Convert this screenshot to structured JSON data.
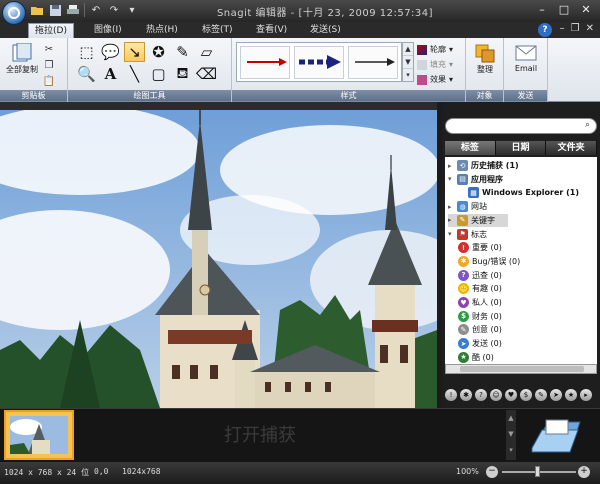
{
  "titlebar": {
    "title": "Snagit 编辑器 - [十月 23, 2009 12:57:34]",
    "qat_icons": [
      "folder-open-icon",
      "save-icon",
      "print-icon",
      "undo-icon",
      "redo-icon",
      "dropdown-icon"
    ]
  },
  "tabs": [
    {
      "label": "拖拉(D)",
      "active": true
    },
    {
      "label": "图像(I)",
      "active": false
    },
    {
      "label": "热点(H)",
      "active": false
    },
    {
      "label": "标签(T)",
      "active": false
    },
    {
      "label": "查看(V)",
      "active": false
    },
    {
      "label": "发送(S)",
      "active": false
    }
  ],
  "ribbon": {
    "clipboard": {
      "label": "剪贴板",
      "copy_all": "全部复制"
    },
    "drawing_tools": {
      "label": "绘图工具"
    },
    "styles": {
      "label": "样式",
      "outline": "轮廓",
      "fill": "填充",
      "effects": "效果"
    },
    "objects": {
      "label": "对象",
      "arrange": "整理"
    },
    "send": {
      "label": "发送",
      "email": "Email"
    }
  },
  "panel": {
    "search_placeholder": "",
    "tabs": [
      "标签",
      "日期",
      "文件夹"
    ],
    "tree": [
      {
        "label": "历史捕获  (1)",
        "indent": 0,
        "icon": "history-icon",
        "expander": "▸",
        "bold": true
      },
      {
        "label": "应用程序",
        "indent": 0,
        "icon": "application-icon",
        "expander": "▾",
        "bold": true
      },
      {
        "label": "Windows Explorer  (1)",
        "indent": 2,
        "icon": "windows-explorer-icon",
        "expander": "",
        "bold": true
      },
      {
        "label": "网站",
        "indent": 0,
        "icon": "web-icon",
        "expander": "▸",
        "bold": false
      },
      {
        "label": "关键字",
        "indent": 0,
        "icon": "keyword-icon",
        "expander": "▸",
        "bold": false,
        "selected": true
      },
      {
        "label": "标志",
        "indent": 0,
        "icon": "flag-icon",
        "expander": "▾",
        "bold": false
      },
      {
        "label": "重要  (0)",
        "indent": 1,
        "icon": "important-icon",
        "color": "#d32f2f",
        "glyph": "!"
      },
      {
        "label": "Bug/错误  (0)",
        "indent": 1,
        "icon": "bug-icon",
        "color": "#f5a623",
        "glyph": "✱"
      },
      {
        "label": "迅查  (0)",
        "indent": 1,
        "icon": "quick-review-icon",
        "color": "#7e57c2",
        "glyph": "?"
      },
      {
        "label": "有趣  (0)",
        "indent": 1,
        "icon": "interesting-icon",
        "color": "#f2b400",
        "glyph": "☺"
      },
      {
        "label": "私人  (0)",
        "indent": 1,
        "icon": "private-icon",
        "color": "#8e44ad",
        "glyph": "♥"
      },
      {
        "label": "财务  (0)",
        "indent": 1,
        "icon": "finance-icon",
        "color": "#2e9e44",
        "glyph": "$"
      },
      {
        "label": "创意  (0)",
        "indent": 1,
        "icon": "idea-icon",
        "color": "#8e8e8e",
        "glyph": "✎"
      },
      {
        "label": "发送  (0)",
        "indent": 1,
        "icon": "send-icon",
        "color": "#3a7bd5",
        "glyph": "➤"
      },
      {
        "label": "酷  (0)",
        "indent": 1,
        "icon": "cool-icon",
        "color": "#2e7d32",
        "glyph": "★"
      }
    ]
  },
  "tray": {
    "hint": "打开捕获"
  },
  "statusbar": {
    "dimensions": "1024 x 768 x 24 位",
    "position": "0,0",
    "selection": "1024x768",
    "zoom": "100%"
  },
  "colors": {
    "accent": "#f0a020",
    "ribbon_label": "#5f7089",
    "arrow_red": "#c40000",
    "arrow_navy": "#1a237e"
  }
}
